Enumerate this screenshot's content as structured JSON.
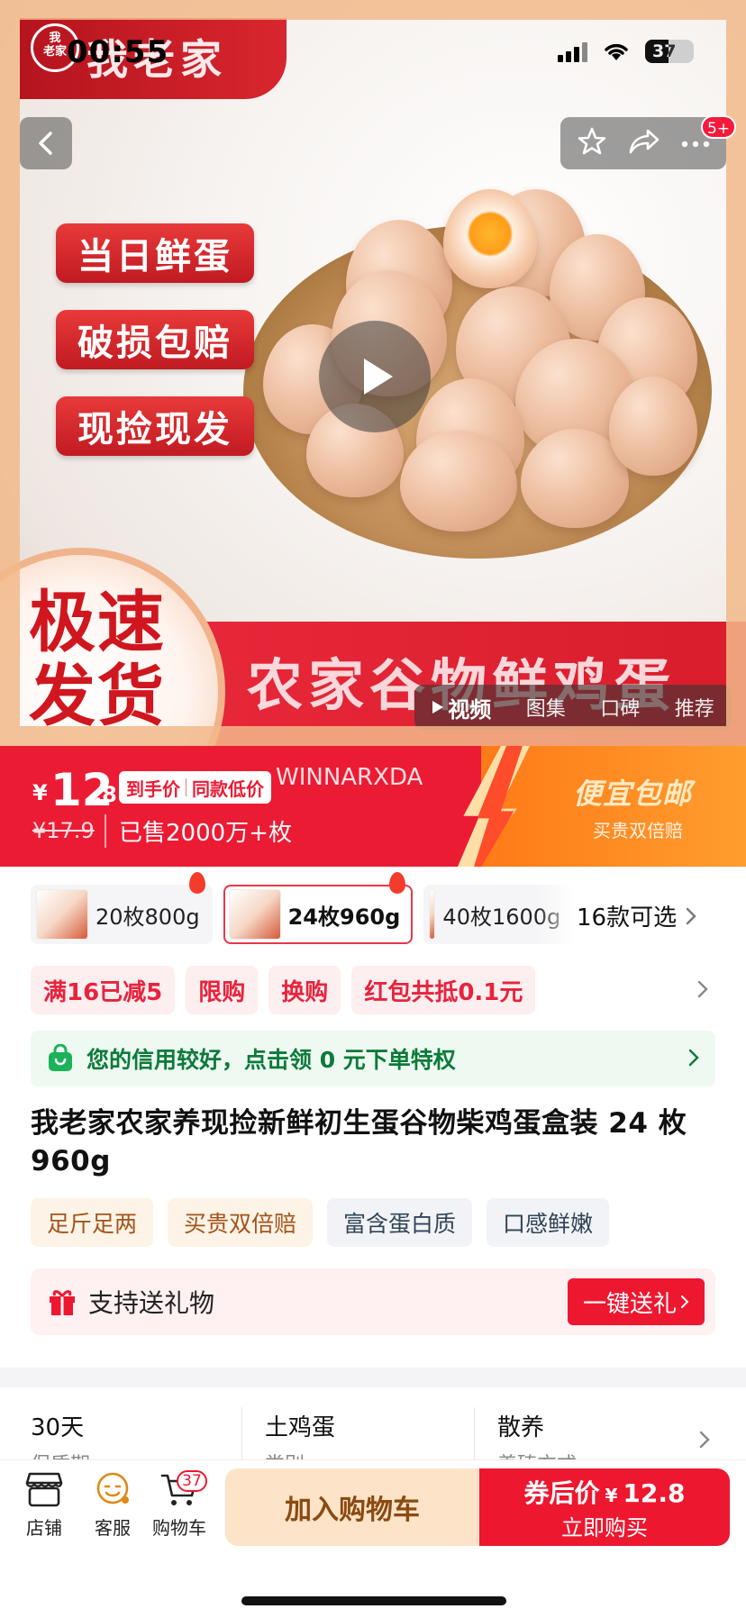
{
  "status_bar": {
    "time": "00:55",
    "battery": "37"
  },
  "hero": {
    "brand": {
      "seal": "我老家",
      "name": "我老家"
    },
    "tags": [
      "当日鲜蛋",
      "破损包赔",
      "现捡现发"
    ],
    "speed_text": "极速发货",
    "product_art_title": "农家谷物鲜鸡蛋",
    "nav_badge": "5+",
    "media_tabs": [
      {
        "label": "视频",
        "active": true
      },
      {
        "label": "图集",
        "active": false
      },
      {
        "label": "口碑",
        "active": false
      },
      {
        "label": "推荐",
        "active": false
      }
    ]
  },
  "price": {
    "currency": "¥",
    "integer": "12",
    "decimal": ".8",
    "tag_left": "到手价",
    "tag_right": "同款低价",
    "watermark": "WINNARXDA",
    "original": "¥17.9",
    "sold": "已售2000万+枚",
    "promo_title": "便宜包邮",
    "promo_sub": "买贵双倍赔"
  },
  "variants": {
    "items": [
      {
        "label": "20枚800g",
        "selected": false,
        "hot": true
      },
      {
        "label": "24枚960g",
        "selected": true,
        "hot": true
      },
      {
        "label": "40枚1600g",
        "selected": false,
        "hot": false
      }
    ],
    "more": "16款可选"
  },
  "coupons": [
    "满16已减5",
    "限购",
    "换购",
    "红包共抵0.1元"
  ],
  "credit": {
    "text": "您的信用较好，点击领 0 元下单特权"
  },
  "product_title": "我老家农家养现捡新鲜初生蛋谷物柴鸡蛋盒装 24 枚 960g",
  "feature_tags": [
    {
      "label": "足斤足两",
      "style": "warm"
    },
    {
      "label": "买贵双倍赔",
      "style": "warm"
    },
    {
      "label": "富含蛋白质",
      "style": "cool"
    },
    {
      "label": "口感鲜嫩",
      "style": "cool"
    }
  ],
  "gift": {
    "text": "支持送礼物",
    "button": "一键送礼"
  },
  "specs": [
    {
      "value": "30天",
      "label": "保质期"
    },
    {
      "value": "土鸡蛋",
      "label": "类别"
    },
    {
      "value": "散养",
      "label": "养殖方式"
    }
  ],
  "bottom_bar": {
    "shop": "店铺",
    "service": "客服",
    "cart": "购物车",
    "cart_count": "37",
    "add_to_cart": "加入购物车",
    "buy_label": "券后价",
    "buy_currency": "¥",
    "buy_price": "12.8",
    "buy_action": "立即购买"
  },
  "colors": {
    "accent": "#ec1b34",
    "promo": "#ff8a20",
    "credit_green": "#0c7a3a"
  }
}
